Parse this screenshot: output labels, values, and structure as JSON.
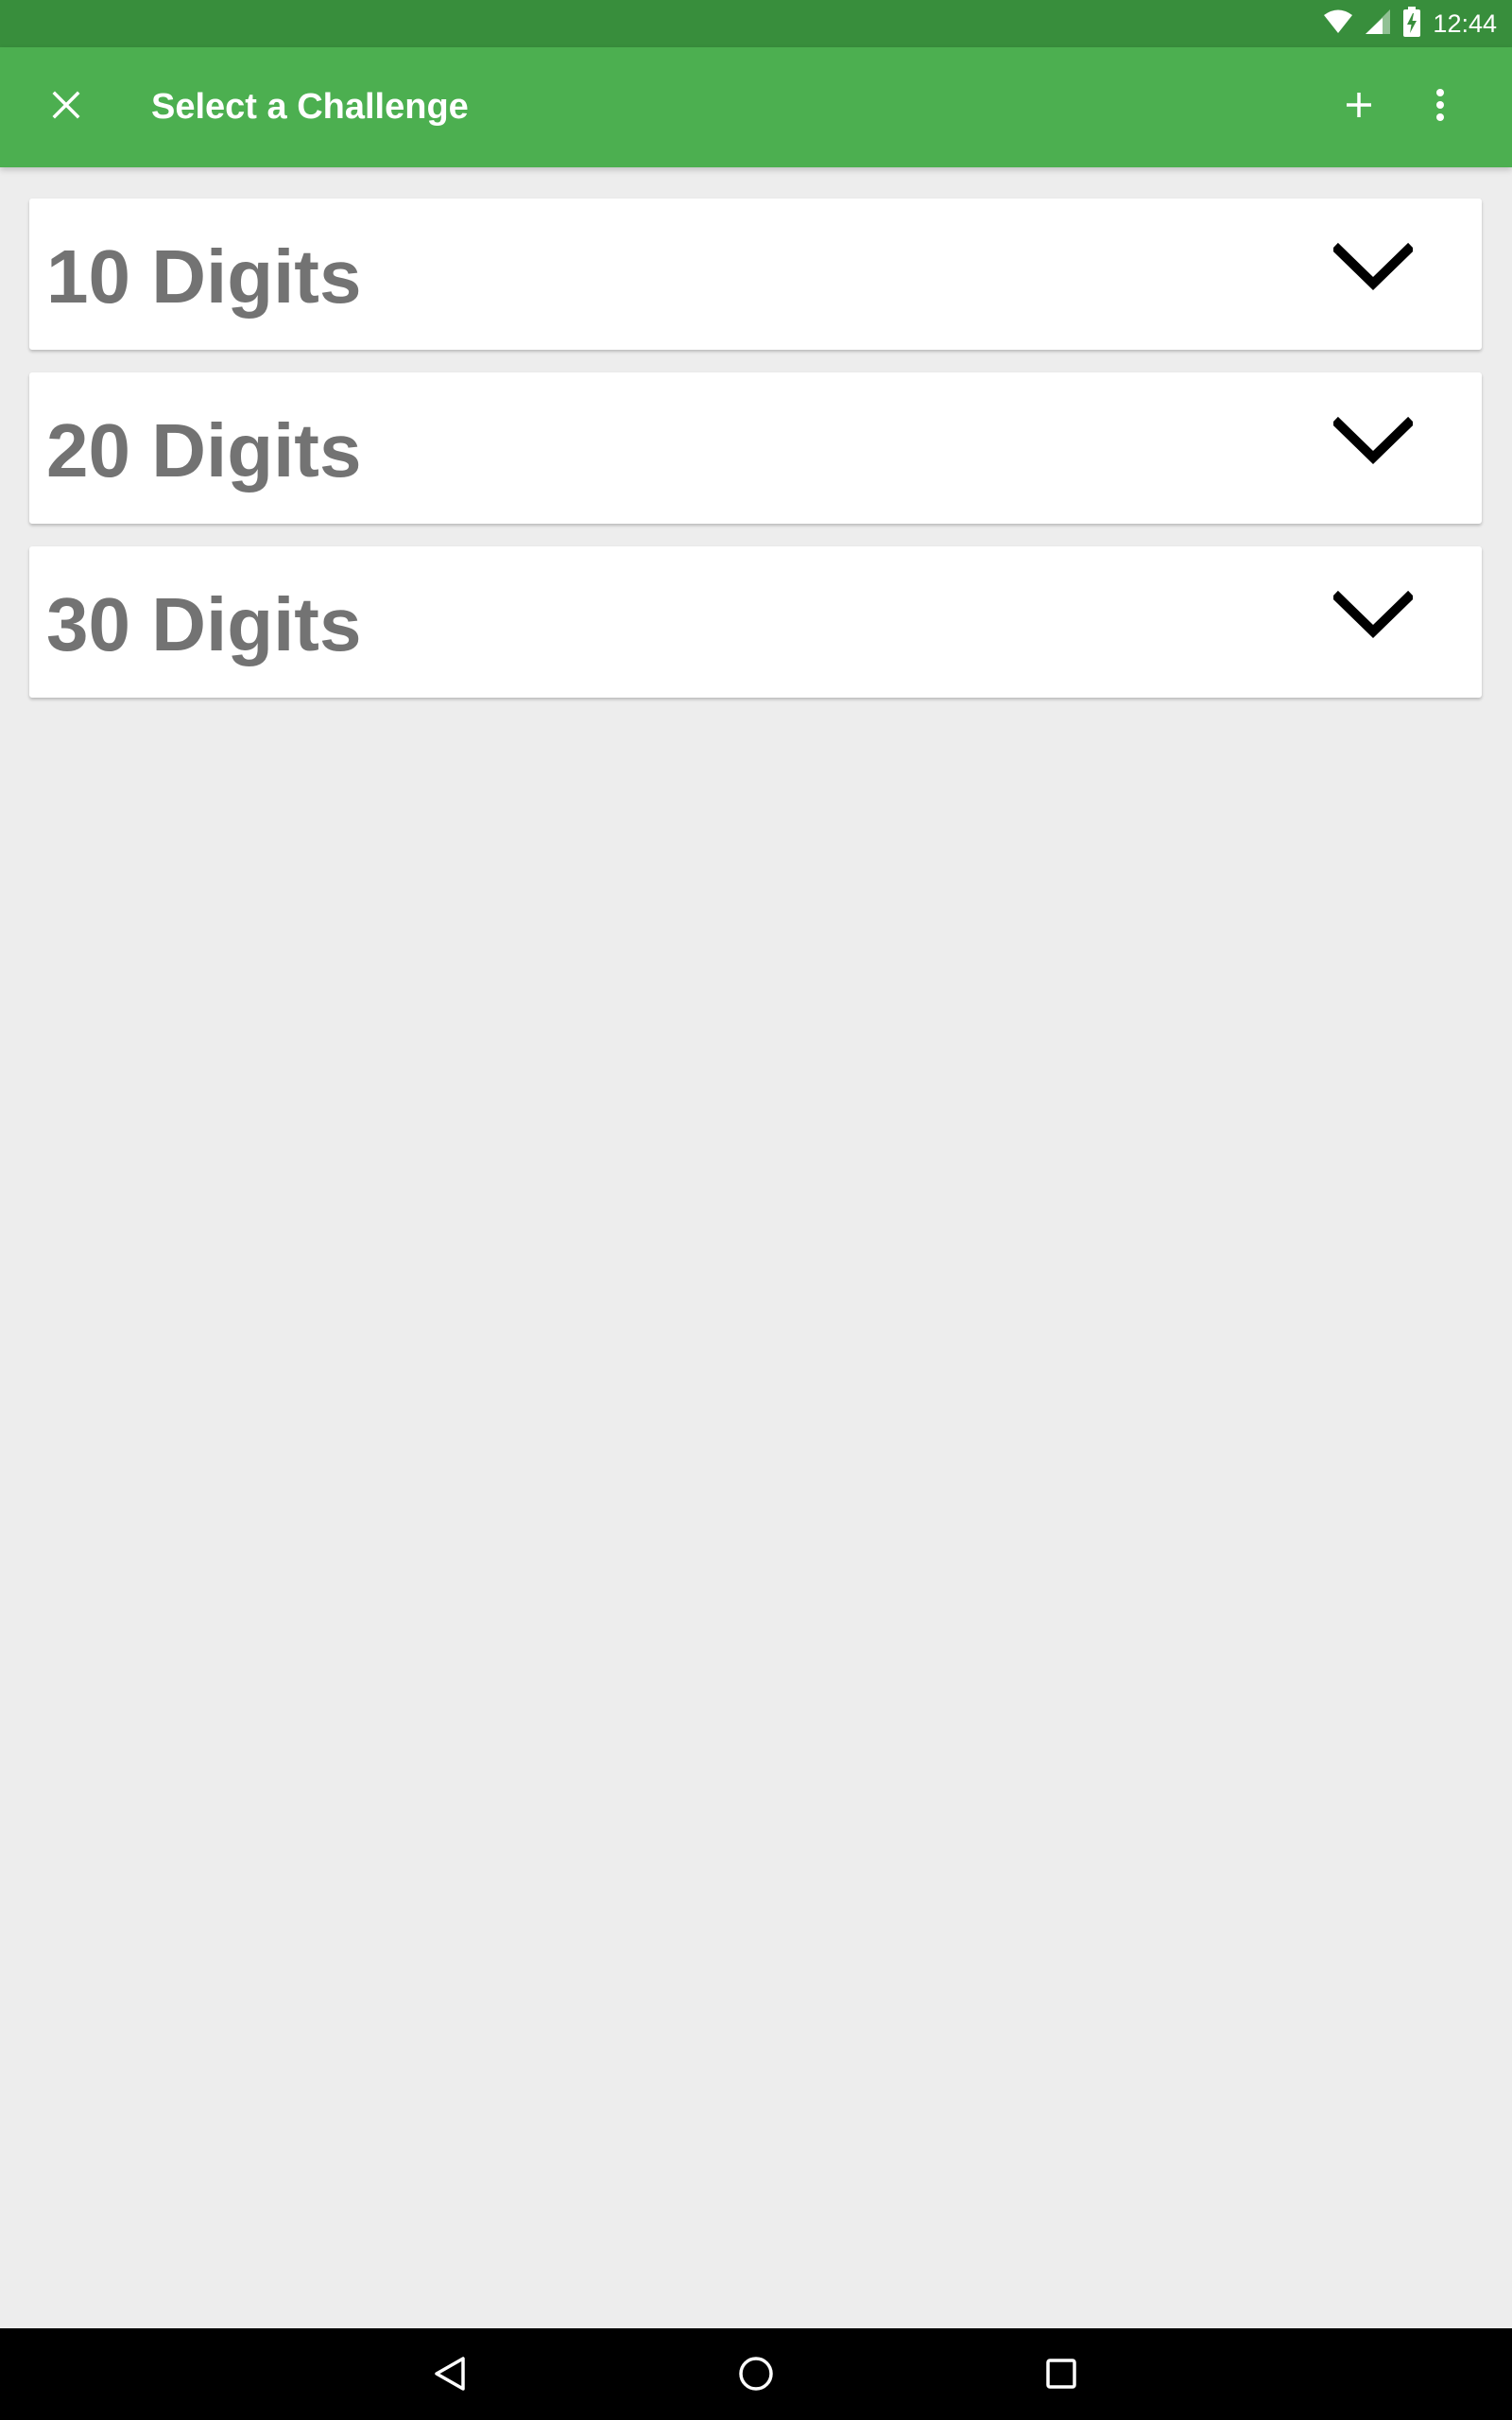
{
  "status_bar": {
    "time": "12:44",
    "icons": [
      "wifi-icon",
      "cell-signal-icon",
      "battery-charging-icon"
    ]
  },
  "app_bar": {
    "title": "Select a Challenge",
    "close_icon": "close-icon",
    "add_icon": "add-icon",
    "more_icon": "more-vert-icon",
    "background": "#4caf50",
    "status_background": "#388e3c"
  },
  "challenges": [
    {
      "label": "10 Digits",
      "icon": "chevron-down-icon"
    },
    {
      "label": "20 Digits",
      "icon": "chevron-down-icon"
    },
    {
      "label": "30 Digits",
      "icon": "chevron-down-icon"
    }
  ],
  "nav_bar": {
    "icons": [
      "back-icon",
      "home-icon",
      "recents-icon"
    ]
  }
}
